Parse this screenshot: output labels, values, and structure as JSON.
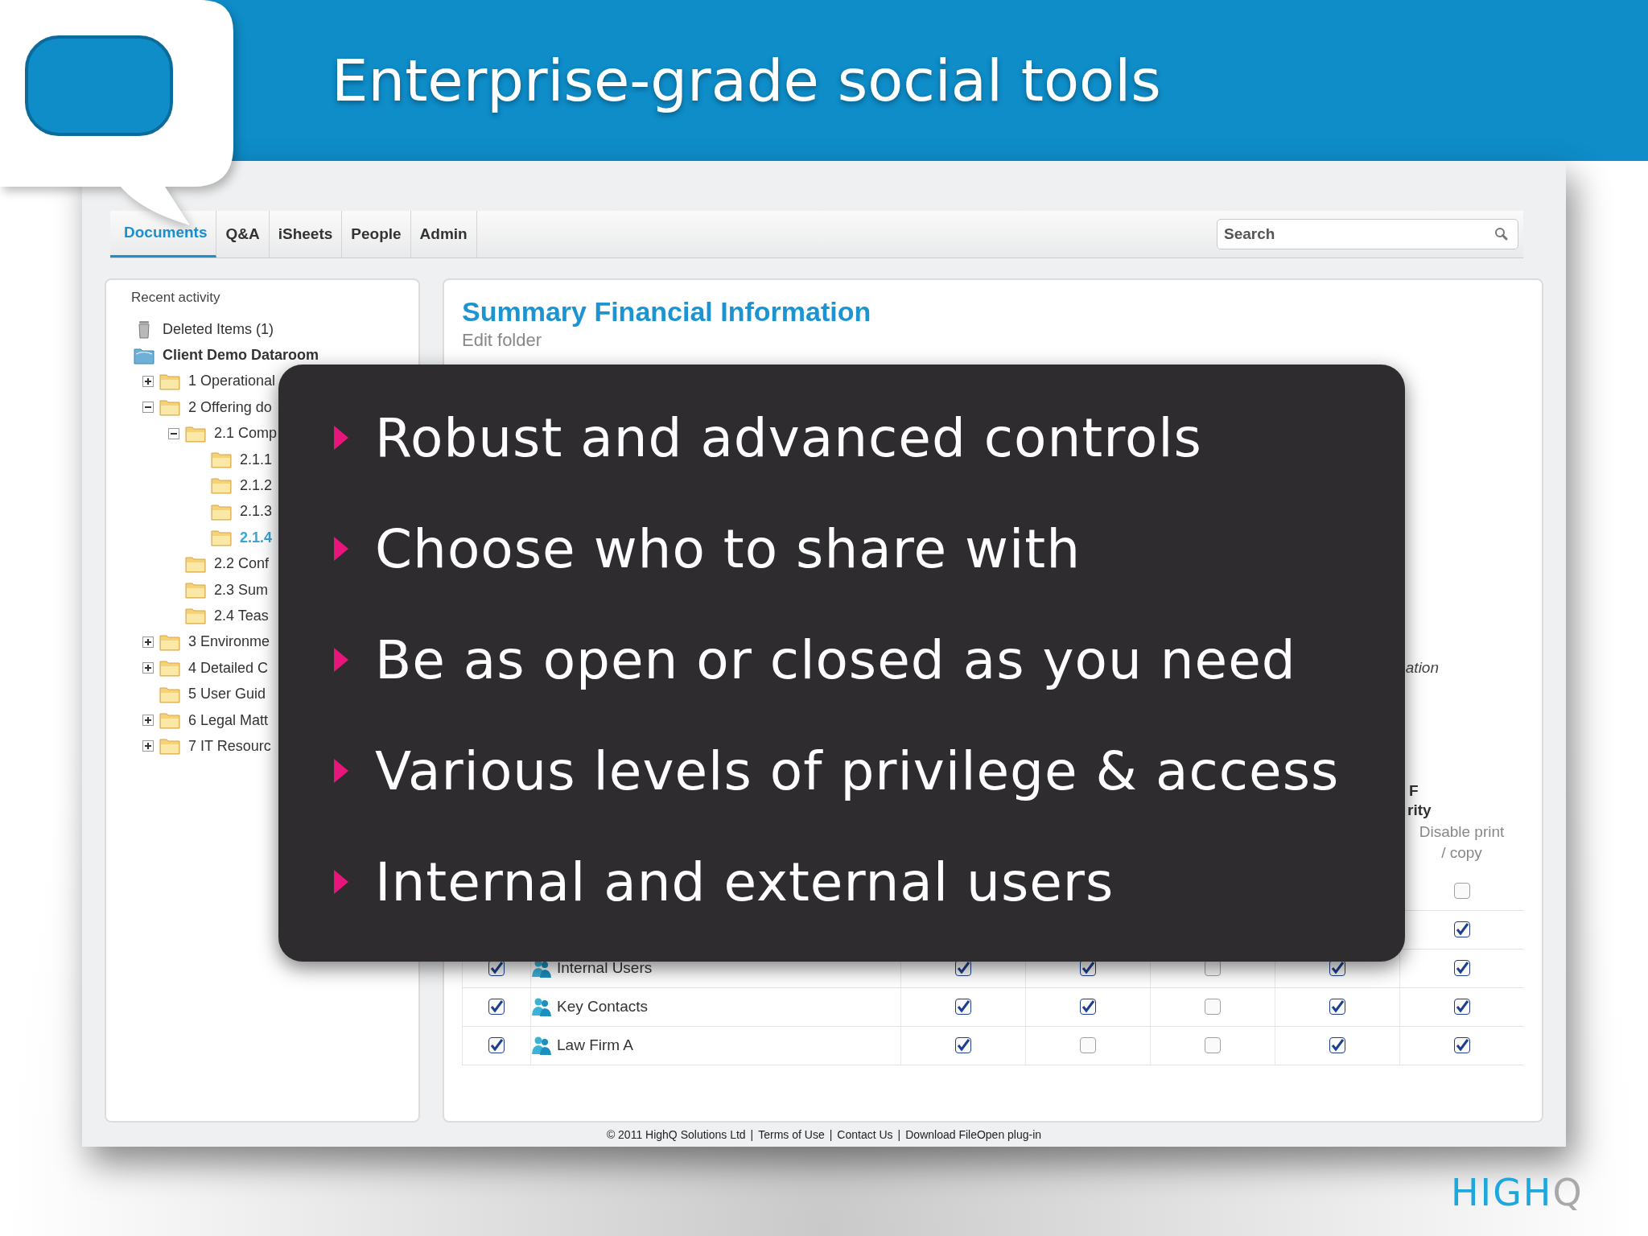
{
  "slide": {
    "title": "Enterprise-grade social tools"
  },
  "nav": {
    "tabs": [
      {
        "label": "Documents",
        "selected": true
      },
      {
        "label": "Q&A",
        "selected": false
      },
      {
        "label": "iSheets",
        "selected": false
      },
      {
        "label": "People",
        "selected": false
      },
      {
        "label": "Admin",
        "selected": false
      }
    ],
    "search": {
      "placeholder": "Search"
    }
  },
  "sidebar": {
    "heading": "Recent activity",
    "tree": [
      {
        "kind": "trash",
        "label": "Deleted Items (1)",
        "selected": false
      },
      {
        "kind": "root",
        "label": "Client Demo Dataroom",
        "selected": false,
        "children": [
          {
            "kind": "folder",
            "label": "1 Operational",
            "expanded": false,
            "selected": false
          },
          {
            "kind": "folder",
            "label": "2 Offering do",
            "expanded": true,
            "selected": false,
            "children": [
              {
                "kind": "folder",
                "label": "2.1 Comp",
                "expanded": true,
                "selected": false,
                "children": [
                  {
                    "kind": "folder",
                    "label": "2.1.1",
                    "selected": false
                  },
                  {
                    "kind": "folder",
                    "label": "2.1.2",
                    "selected": false
                  },
                  {
                    "kind": "folder",
                    "label": "2.1.3",
                    "selected": false
                  },
                  {
                    "kind": "folder",
                    "label": "2.1.4",
                    "selected": true
                  }
                ]
              },
              {
                "kind": "folder",
                "label": "2.2 Conf",
                "selected": false
              },
              {
                "kind": "folder",
                "label": "2.3 Sum",
                "selected": false
              },
              {
                "kind": "folder",
                "label": "2.4 Teas",
                "selected": false
              }
            ]
          },
          {
            "kind": "folder",
            "label": "3 Environme",
            "expanded": false,
            "selected": false
          },
          {
            "kind": "folder",
            "label": "4 Detailed C",
            "expanded": false,
            "selected": false
          },
          {
            "kind": "folder",
            "label": "5 User Guid",
            "selected": false
          },
          {
            "kind": "folder",
            "label": "6 Legal Matt",
            "expanded": false,
            "selected": false
          },
          {
            "kind": "folder",
            "label": "7 IT Resourc",
            "expanded": false,
            "selected": false
          }
        ]
      }
    ]
  },
  "content": {
    "title": "Summary Financial Information",
    "subtitle": "Edit folder",
    "note": "ation",
    "table": {
      "group_header": [
        "F",
        "rity"
      ],
      "column_header": "Disable print / copy",
      "rows": [
        {
          "disable_print": false
        },
        {
          "disable_print": true
        },
        {
          "checked": true,
          "name": "Internal Users",
          "permissions": [
            true,
            true,
            false,
            true
          ],
          "disable_print": true
        },
        {
          "checked": true,
          "name": "Key Contacts",
          "permissions": [
            true,
            true,
            false,
            true
          ],
          "disable_print": true
        },
        {
          "checked": true,
          "name": "Law Firm A",
          "permissions": [
            true,
            false,
            false,
            true
          ],
          "disable_print": true
        }
      ]
    }
  },
  "footer": {
    "separator": "|",
    "items": [
      "© 2011 HighQ Solutions Ltd",
      "Terms of Use",
      "Contact Us",
      "Download FileOpen plug-in"
    ]
  },
  "overlay": {
    "bullets": [
      "Robust and advanced controls",
      "Choose who to share with",
      "Be as open or closed as you need",
      "Various levels of privilege & access",
      "Internal and external users"
    ]
  },
  "logo": {
    "main": "HIGH",
    "accent": "Q"
  }
}
